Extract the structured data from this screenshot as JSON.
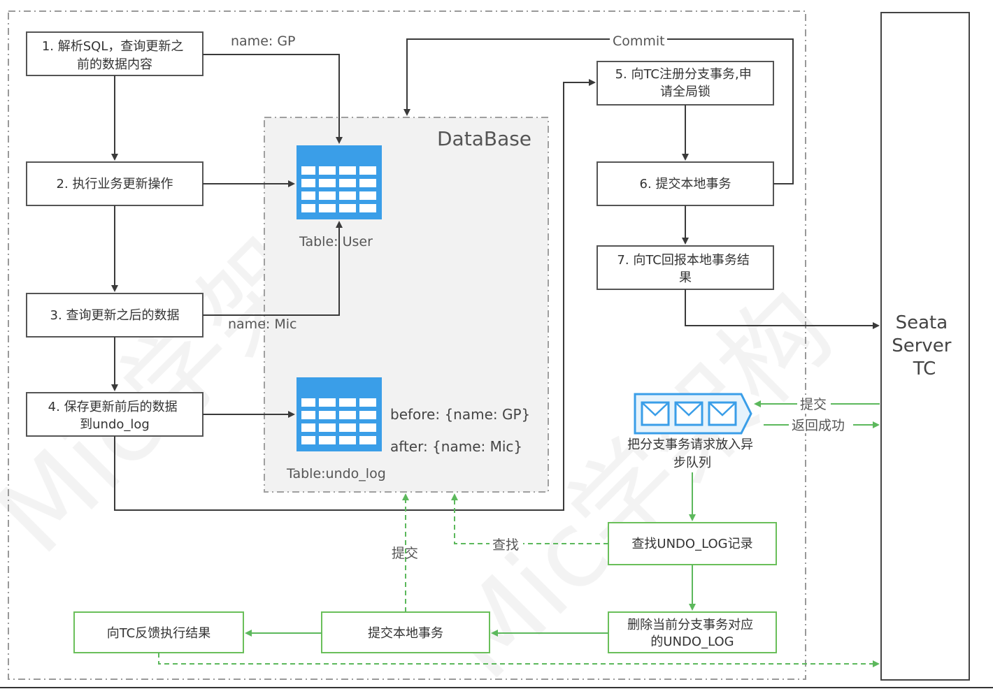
{
  "steps": {
    "s1": [
      "1. 解析SQL，查询更新之",
      "前的数据内容"
    ],
    "s2": "2. 执行业务更新操作",
    "s3": "3. 查询更新之后的数据",
    "s4": [
      "4. 保存更新前后的数据",
      "到undo_log"
    ],
    "s5": [
      "5. 向TC注册分支事务,申",
      "请全局锁"
    ],
    "s6": "6. 提交本地事务",
    "s7": [
      "7. 向TC回报本地事务结",
      "果"
    ]
  },
  "async_steps": {
    "find_undo": "查找UNDO_LOG记录",
    "delete_undo": [
      "删除当前分支事务对应",
      "的UNDO_LOG"
    ],
    "commit_local": "提交本地事务",
    "feedback_tc": "向TC反馈执行结果"
  },
  "database": {
    "title": "DataBase",
    "table_user": "Table: User",
    "table_undo": "Table:undo_log",
    "before": "before:  {name: GP}",
    "after": "after:  {name: Mic}"
  },
  "edge_labels": {
    "name_gp": "name: GP",
    "name_mic": "name: Mic",
    "commit": "Commit",
    "submit_top": "提交",
    "return_success": "返回成功",
    "find": "查找",
    "submit_bottom": "提交"
  },
  "queue_label": [
    "把分支事务请求放入异",
    "步队列"
  ],
  "seata": [
    "Seata",
    "Server",
    "TC"
  ],
  "watermark": "Mic学架构",
  "colors": {
    "table_blue": "#3a9ee8",
    "green": "#5cb85c",
    "db_fill": "#f2f2f2"
  }
}
